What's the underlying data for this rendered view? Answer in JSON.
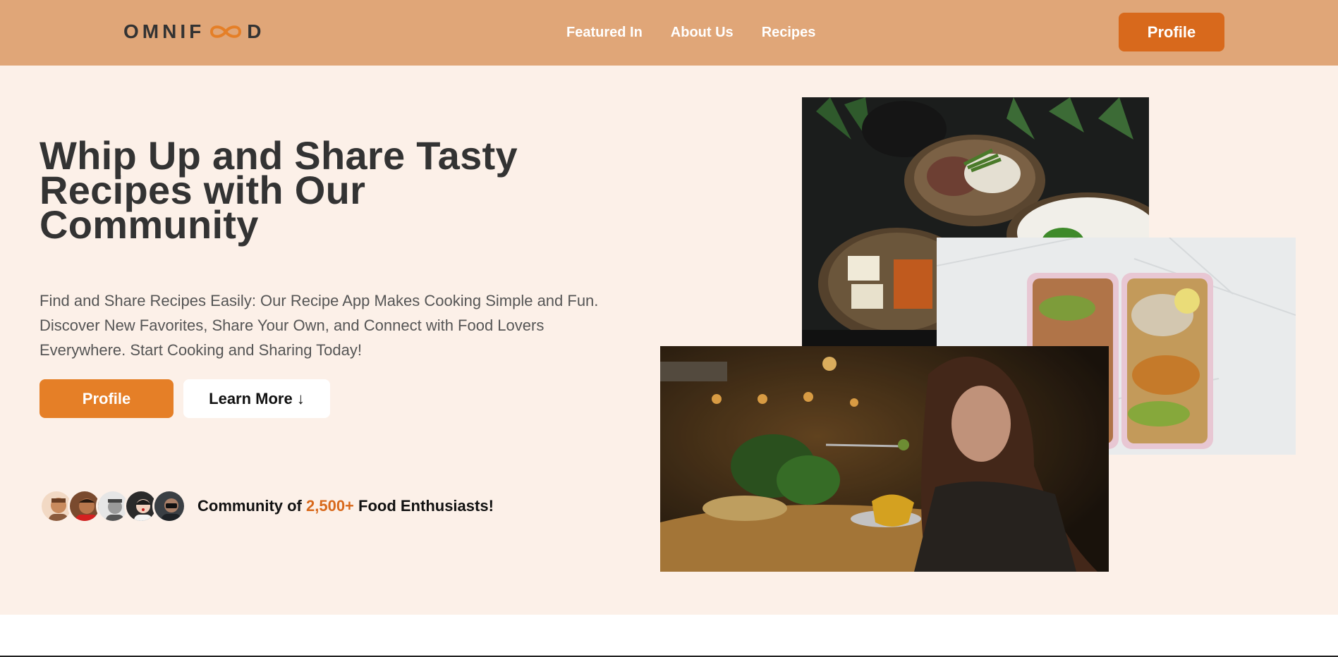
{
  "header": {
    "logo_text_left": "OMNIF",
    "logo_text_right": "D",
    "nav": [
      "Featured In",
      "About Us",
      "Recipes"
    ],
    "profile_label": "Profile"
  },
  "hero": {
    "title": "Whip Up and Share Tasty Recipes with Our Community",
    "description": "Find and Share Recipes Easily: Our Recipe App Makes Cooking Simple and Fun. Discover New Favorites, Share Your Own, and Connect with Food Lovers Everywhere. Start Cooking and Sharing Today!",
    "primary_button": "Profile",
    "secondary_button": "Learn More ↓",
    "community_prefix": "Community of ",
    "community_highlight": "2,500+",
    "community_suffix": " Food Enthusiasts!"
  },
  "colors": {
    "header_bg": "#e0a678",
    "hero_bg": "#fcf0e8",
    "accent": "#e57f27",
    "accent_dark": "#d8691c"
  },
  "icons": [
    "infinity-logo-icon"
  ]
}
